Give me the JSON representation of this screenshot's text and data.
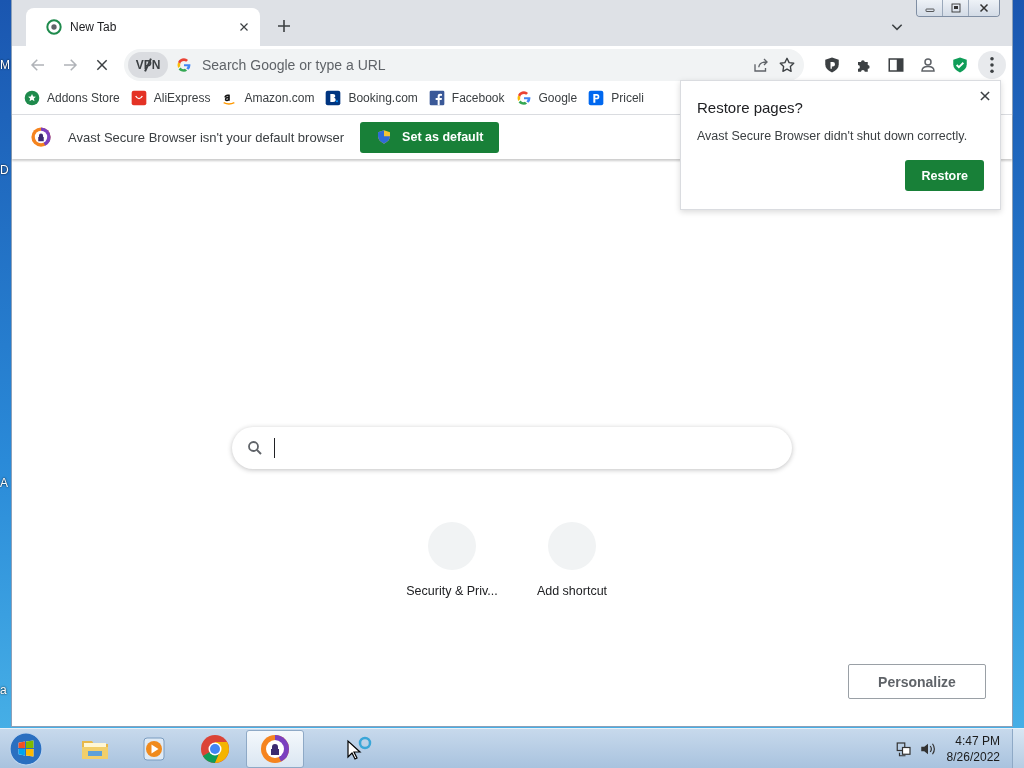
{
  "desktop_labels": [
    "M",
    "D",
    "A",
    "a"
  ],
  "tabs": [
    {
      "title": "New Tab",
      "selected": true
    }
  ],
  "toolbar": {
    "vpn_label": "VPN",
    "address_placeholder": "Search Google or type a URL"
  },
  "bookmarks": [
    {
      "label": "Addons Store",
      "kind": "addons"
    },
    {
      "label": "AliExpress",
      "kind": "aliexpress"
    },
    {
      "label": "Amazon.com",
      "kind": "amazon"
    },
    {
      "label": "Booking.com",
      "kind": "booking"
    },
    {
      "label": "Facebook",
      "kind": "facebook"
    },
    {
      "label": "Google",
      "kind": "google"
    },
    {
      "label": "Priceli",
      "kind": "priceline"
    }
  ],
  "infobar": {
    "message": "Avast Secure Browser isn't your default browser",
    "button": "Set as default"
  },
  "restore_popup": {
    "title": "Restore pages?",
    "message": "Avast Secure Browser didn't shut down correctly.",
    "button": "Restore"
  },
  "shortcuts": [
    {
      "label": "Security & Priv..."
    },
    {
      "label": "Add shortcut"
    }
  ],
  "personalize_button": "Personalize",
  "taskbar": {
    "apps": [
      {
        "kind": "explorer",
        "selected": false
      },
      {
        "kind": "media",
        "selected": false
      },
      {
        "kind": "chrome",
        "selected": false
      },
      {
        "kind": "avast",
        "selected": true
      }
    ],
    "time": "4:47 PM",
    "date": "8/26/2022"
  }
}
